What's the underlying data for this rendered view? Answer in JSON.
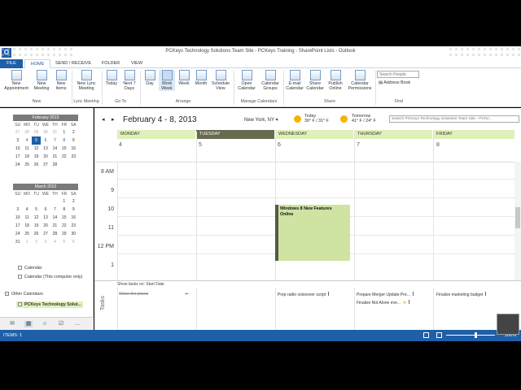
{
  "window": {
    "title": "PCKeys Technology Solutions Team Site - PCKeys Training - SharePoint Lists - Outlook"
  },
  "tabs": [
    "FILE",
    "HOME",
    "SEND / RECEIVE",
    "FOLDER",
    "VIEW"
  ],
  "ribbon": {
    "new_appointment": "New Appointment",
    "new_meeting": "New Meeting",
    "new_items": "New Items",
    "new_lync": "New Lync Meeting",
    "today": "Today",
    "next7": "Next 7 Days",
    "day": "Day",
    "work_week": "Work Week",
    "week": "Week",
    "month": "Month",
    "schedule": "Schedule View",
    "open_cal": "Open Calendar",
    "cal_groups": "Calendar Groups",
    "email_cal": "E-mail Calendar",
    "share_cal": "Share Calendar",
    "publish": "Publish Online",
    "permissions": "Calendar Permissions",
    "search_people": "Search People",
    "address_book": "Address Book",
    "groups": {
      "new": "New",
      "lync": "Lync Meeting",
      "goto": "Go To",
      "arrange": "Arrange",
      "manage": "Manage Calendars",
      "share": "Share",
      "find": "Find"
    }
  },
  "feb": {
    "title": "February 2013",
    "days": [
      "SU",
      "MO",
      "TU",
      "WE",
      "TH",
      "FR",
      "SA"
    ],
    "rows": [
      [
        "27",
        "28",
        "29",
        "30",
        "31",
        "1",
        "2"
      ],
      [
        "3",
        "4",
        "5",
        "6",
        "7",
        "8",
        "9"
      ],
      [
        "10",
        "11",
        "12",
        "13",
        "14",
        "15",
        "16"
      ],
      [
        "17",
        "18",
        "19",
        "20",
        "21",
        "22",
        "23"
      ],
      [
        "24",
        "25",
        "26",
        "27",
        "28",
        "",
        " "
      ]
    ]
  },
  "mar": {
    "title": "March 2013",
    "rows": [
      [
        "",
        "",
        "",
        "",
        "",
        "1",
        "2"
      ],
      [
        "3",
        "4",
        "5",
        "6",
        "7",
        "8",
        "9"
      ],
      [
        "10",
        "11",
        "12",
        "13",
        "14",
        "15",
        "16"
      ],
      [
        "17",
        "18",
        "19",
        "20",
        "21",
        "22",
        "23"
      ],
      [
        "24",
        "25",
        "26",
        "27",
        "28",
        "29",
        "30"
      ],
      [
        "31",
        "1",
        "2",
        "3",
        "4",
        "5",
        "6"
      ]
    ]
  },
  "calendars": {
    "item1": "Calendar",
    "item2": "Calendar (This computer only)",
    "other": "Other Calendars",
    "shared": "PCKeys Technology Solut..."
  },
  "header": {
    "range": "February 4 - 8, 2013",
    "location": "New York, NY",
    "today_lbl": "Today",
    "today_temp": "30° F / 31° F",
    "tomorrow_lbl": "Tomorrow",
    "tomorrow_temp": "41° F / 24° F",
    "search": "Search PCKeys Technology Solutions Team Site - PCKe..."
  },
  "days": [
    {
      "name": "MONDAY",
      "num": "4"
    },
    {
      "name": "TUESDAY",
      "num": "5"
    },
    {
      "name": "WEDNESDAY",
      "num": "6"
    },
    {
      "name": "THURSDAY",
      "num": "7"
    },
    {
      "name": "FRIDAY",
      "num": "8"
    }
  ],
  "hours": [
    "8 AM",
    "9",
    "10",
    "11",
    "12 PM",
    "1"
  ],
  "appointment": {
    "title": "Windows 8 New Features",
    "location": "Online"
  },
  "tasks": {
    "bar": "Show tasks on: Start Date",
    "label": "Tasks",
    "t1": "Water the plants",
    "t2": "Prep radio voiceover script",
    "t3": "Prepare Merger Update Pre...",
    "t4": "Finalize Not Alone eve...",
    "t5": "Finalize marketing budget"
  },
  "status": {
    "items": "ITEMS: 1",
    "zoom": "100%"
  }
}
